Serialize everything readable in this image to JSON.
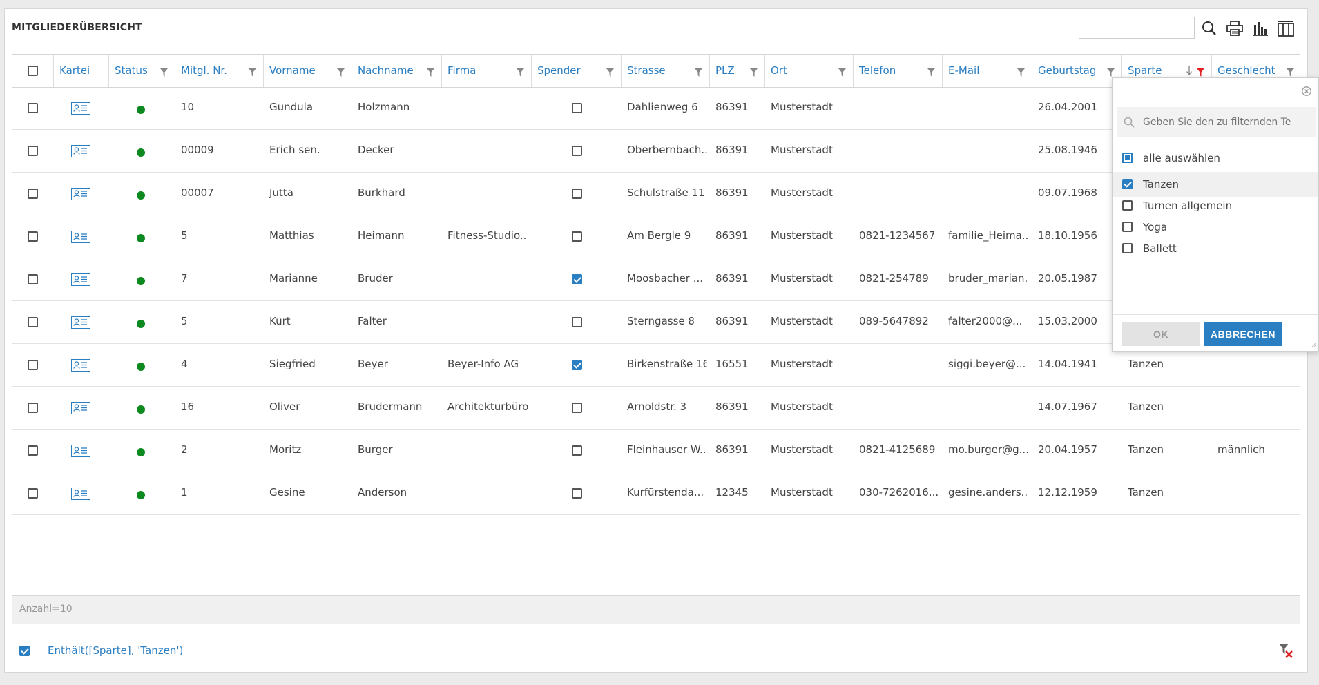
{
  "title": "MITGLIEDERÜBERSICHT",
  "toolbar": {
    "icons": [
      "search-icon",
      "print-icon",
      "chart-icon",
      "columns-icon"
    ]
  },
  "columns": [
    "Kartei",
    "Status",
    "Mitgl. Nr.",
    "Vorname",
    "Nachname",
    "Firma",
    "Spender",
    "Strasse",
    "PLZ",
    "Ort",
    "Telefon",
    "E-Mail",
    "Geburtstag",
    "Sparte",
    "Geschlecht"
  ],
  "rows": [
    {
      "nr": "10",
      "vorname": "Gundula",
      "nachname": "Holzmann",
      "firma": "",
      "spender": false,
      "strasse": "Dahlienweg 6",
      "plz": "86391",
      "ort": "Musterstadt",
      "telefon": "",
      "email": "",
      "geburtstag": "26.04.2001",
      "sparte": "",
      "geschlecht": ""
    },
    {
      "nr": "00009",
      "vorname": "Erich sen.",
      "nachname": "Decker",
      "firma": "",
      "spender": false,
      "strasse": "Oberbernbach...",
      "plz": "86391",
      "ort": "Musterstadt",
      "telefon": "",
      "email": "",
      "geburtstag": "25.08.1946",
      "sparte": "",
      "geschlecht": ""
    },
    {
      "nr": "00007",
      "vorname": "Jutta",
      "nachname": "Burkhard",
      "firma": "",
      "spender": false,
      "strasse": "Schulstraße 11",
      "plz": "86391",
      "ort": "Musterstadt",
      "telefon": "",
      "email": "",
      "geburtstag": "09.07.1968",
      "sparte": "",
      "geschlecht": ""
    },
    {
      "nr": "5",
      "vorname": "Matthias",
      "nachname": "Heimann",
      "firma": "Fitness-Studio...",
      "spender": false,
      "strasse": "Am Bergle 9",
      "plz": "86391",
      "ort": "Musterstadt",
      "telefon": "0821-1234567",
      "email": "familie_Heima...",
      "geburtstag": "18.10.1956",
      "sparte": "",
      "geschlecht": ""
    },
    {
      "nr": "7",
      "vorname": "Marianne",
      "nachname": "Bruder",
      "firma": "",
      "spender": true,
      "strasse": "Moosbacher ...",
      "plz": "86391",
      "ort": "Musterstadt",
      "telefon": "0821-254789",
      "email": "bruder_marian...",
      "geburtstag": "20.05.1987",
      "sparte": "",
      "geschlecht": ""
    },
    {
      "nr": "5",
      "vorname": "Kurt",
      "nachname": "Falter",
      "firma": "",
      "spender": false,
      "strasse": "Sterngasse 8",
      "plz": "86391",
      "ort": "Musterstadt",
      "telefon": "089-5647892",
      "email": "falter2000@...",
      "geburtstag": "15.03.2000",
      "sparte": "",
      "geschlecht": ""
    },
    {
      "nr": "4",
      "vorname": "Siegfried",
      "nachname": "Beyer",
      "firma": "Beyer-Info AG",
      "spender": true,
      "strasse": "Birkenstraße 16",
      "plz": "16551",
      "ort": "Musterstadt",
      "telefon": "",
      "email": "siggi.beyer@...",
      "geburtstag": "14.04.1941",
      "sparte": "Tanzen",
      "geschlecht": ""
    },
    {
      "nr": "16",
      "vorname": "Oliver",
      "nachname": "Brudermann",
      "firma": "Architekturbüro",
      "spender": false,
      "strasse": "Arnoldstr. 3",
      "plz": "86391",
      "ort": "Musterstadt",
      "telefon": "",
      "email": "",
      "geburtstag": "14.07.1967",
      "sparte": "Tanzen",
      "geschlecht": ""
    },
    {
      "nr": "2",
      "vorname": "Moritz",
      "nachname": "Burger",
      "firma": "",
      "spender": false,
      "strasse": "Fleinhauser W...",
      "plz": "86391",
      "ort": "Musterstadt",
      "telefon": "0821-4125689",
      "email": "mo.burger@g...",
      "geburtstag": "20.04.1957",
      "sparte": "Tanzen",
      "geschlecht": "männlich"
    },
    {
      "nr": "1",
      "vorname": "Gesine",
      "nachname": "Anderson",
      "firma": "",
      "spender": false,
      "strasse": "Kurfürstenda...",
      "plz": "12345",
      "ort": "Musterstadt",
      "telefon": "030-7262016...",
      "email": "gesine.anders...",
      "geburtstag": "12.12.1959",
      "sparte": "Tanzen",
      "geschlecht": ""
    }
  ],
  "footer": {
    "count_label": "Anzahl=10"
  },
  "filterbar": {
    "expression": "Enthält([Sparte], 'Tanzen')",
    "checked": true
  },
  "popup": {
    "search_placeholder": "Geben Sie den zu filternden Te",
    "select_all_label": "alle auswählen",
    "options": [
      {
        "label": "Tanzen",
        "checked": true
      },
      {
        "label": "Turnen allgemein",
        "checked": false
      },
      {
        "label": "Yoga",
        "checked": false
      },
      {
        "label": "Ballett",
        "checked": false
      }
    ],
    "ok_label": "OK",
    "cancel_label": "ABBRECHEN"
  },
  "colors": {
    "accent": "#2a7ec2",
    "status_active": "#0d8a1f",
    "filter_active": "#e02020"
  }
}
